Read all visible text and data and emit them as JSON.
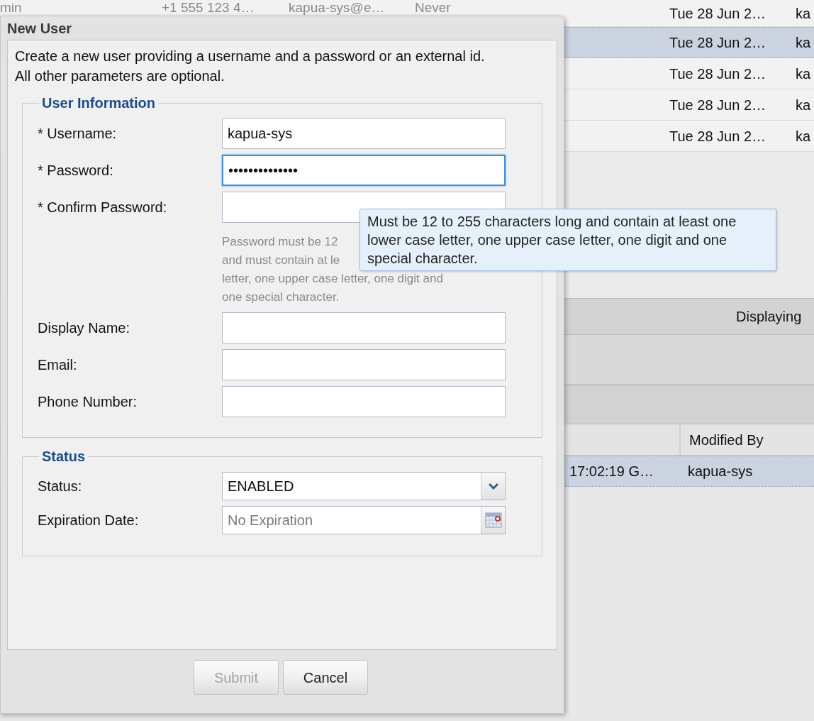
{
  "background_grid": {
    "rows": [
      {
        "left_cells": [
          "min",
          "+1 555 123 4…",
          "kapua-sys@e…",
          "Never"
        ],
        "right_cells": [
          "Tue 28 Jun 2…",
          "ka"
        ],
        "selected": false
      },
      {
        "right_cells": [
          "Tue 28 Jun 2…",
          "ka"
        ],
        "selected": true
      },
      {
        "right_cells": [
          "Tue 28 Jun 2…",
          "ka"
        ],
        "selected": false
      },
      {
        "right_cells": [
          "Tue 28 Jun 2…",
          "ka"
        ],
        "selected": false
      },
      {
        "right_cells": [
          "Tue 28 Jun 2…",
          "ka"
        ],
        "selected": false
      }
    ]
  },
  "paging_toolbar": {
    "text": "Displaying"
  },
  "detail_grid": {
    "columns": [
      "",
      "Modified By"
    ],
    "rows": [
      {
        "cells": [
          "17:02:19 G…",
          "kapua-sys"
        ],
        "selected": true
      }
    ]
  },
  "dialog": {
    "title": "New User",
    "description": [
      "Create a new user providing a username and a password or an external id.",
      "All other parameters are optional."
    ],
    "sections": [
      {
        "legend": "User Information",
        "fields": [
          {
            "kind": "text",
            "label": "* Username:",
            "value": "kapua-sys",
            "focused": false
          },
          {
            "kind": "text",
            "label": "* Password:",
            "value": "••••••••••••••",
            "focused": true
          },
          {
            "kind": "text",
            "label": "* Confirm Password:",
            "focused": false,
            "hint_lines": [
              "Password must be 12",
              "and must contain at le",
              "letter, one upper case letter, one digit and",
              "one special character."
            ]
          },
          {
            "kind": "text",
            "label": "Display Name:",
            "focused": false
          },
          {
            "kind": "text",
            "label": "Email:",
            "focused": false
          },
          {
            "kind": "text",
            "label": "Phone Number:",
            "focused": false
          }
        ]
      },
      {
        "legend": "Status",
        "fields": [
          {
            "kind": "select",
            "label": "Status:",
            "value": "ENABLED",
            "focused": false
          },
          {
            "kind": "date",
            "label": "Expiration Date:",
            "placeholder": "No Expiration",
            "focused": false
          }
        ]
      }
    ],
    "buttons": [
      {
        "label": "Submit",
        "disabled": true
      },
      {
        "label": "Cancel",
        "disabled": false
      }
    ],
    "tooltip": "Must be 12 to 255 characters long and contain at least one lower case letter, one upper case letter, one digit and one special character."
  }
}
